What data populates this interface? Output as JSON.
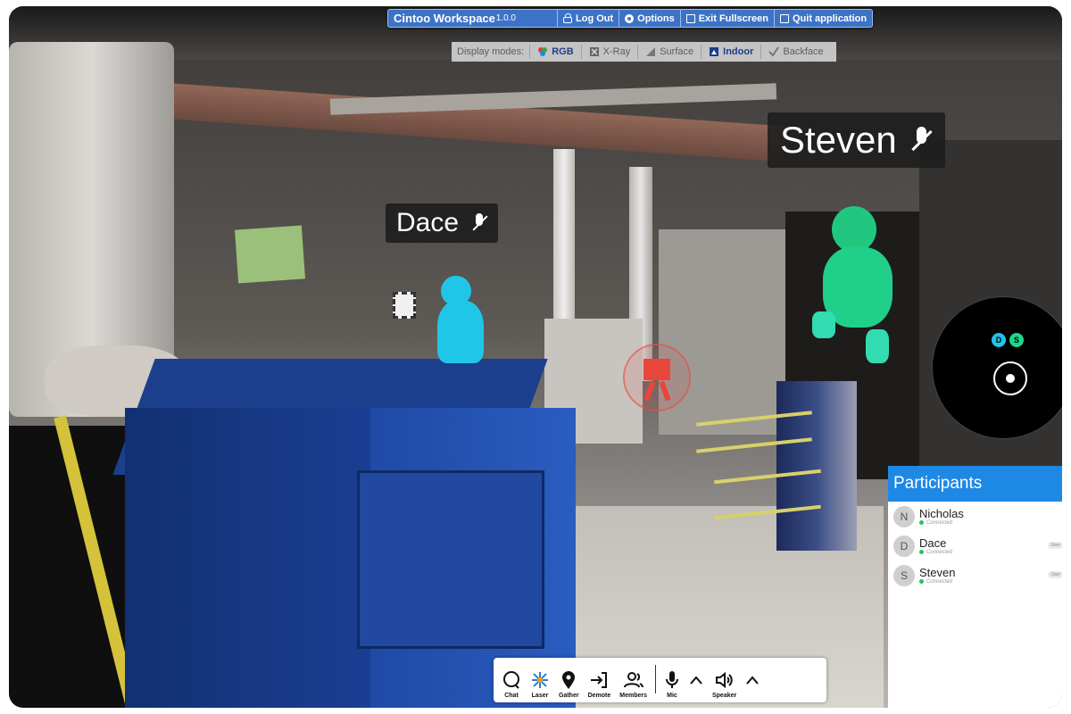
{
  "topbar": {
    "app_name": "Cintoo Workspace",
    "version": "1.0.0",
    "logout_label": "Log Out",
    "options_label": "Options",
    "exit_fullscreen_label": "Exit Fullscreen",
    "quit_label": "Quit application",
    "color": "#3d73c7"
  },
  "display_modes": {
    "label": "Display modes:",
    "modes": [
      {
        "label": "RGB",
        "icon": "rgb-icon",
        "active": true
      },
      {
        "label": "X-Ray",
        "icon": "xray-icon",
        "active": false
      },
      {
        "label": "Surface",
        "icon": "surface-icon",
        "active": false
      },
      {
        "label": "Indoor",
        "icon": "indoor-icon",
        "active": true
      },
      {
        "label": "Backface",
        "icon": "backface-icon",
        "active": false
      }
    ]
  },
  "avatars": [
    {
      "name": "Dace",
      "muted": true,
      "color": "#1fc6e8"
    },
    {
      "name": "Steven",
      "muted": true,
      "color": "#1fd68a"
    }
  ],
  "minimap": {
    "markers": [
      {
        "initial": "D",
        "color": "#1fc6e8"
      },
      {
        "initial": "S",
        "color": "#1fd68a"
      }
    ]
  },
  "participants": {
    "title": "Participants",
    "items": [
      {
        "initial": "N",
        "name": "Nicholas",
        "status": "Connected"
      },
      {
        "initial": "D",
        "name": "Dace",
        "status": "Connected",
        "badge": "User"
      },
      {
        "initial": "S",
        "name": "Steven",
        "status": "Connected",
        "badge": "User"
      }
    ]
  },
  "toolbar": {
    "chat_label": "Chat",
    "laser_label": "Laser",
    "gather_label": "Gather",
    "demote_label": "Demote",
    "members_label": "Members",
    "mic_label": "Mic",
    "speaker_label": "Speaker"
  }
}
